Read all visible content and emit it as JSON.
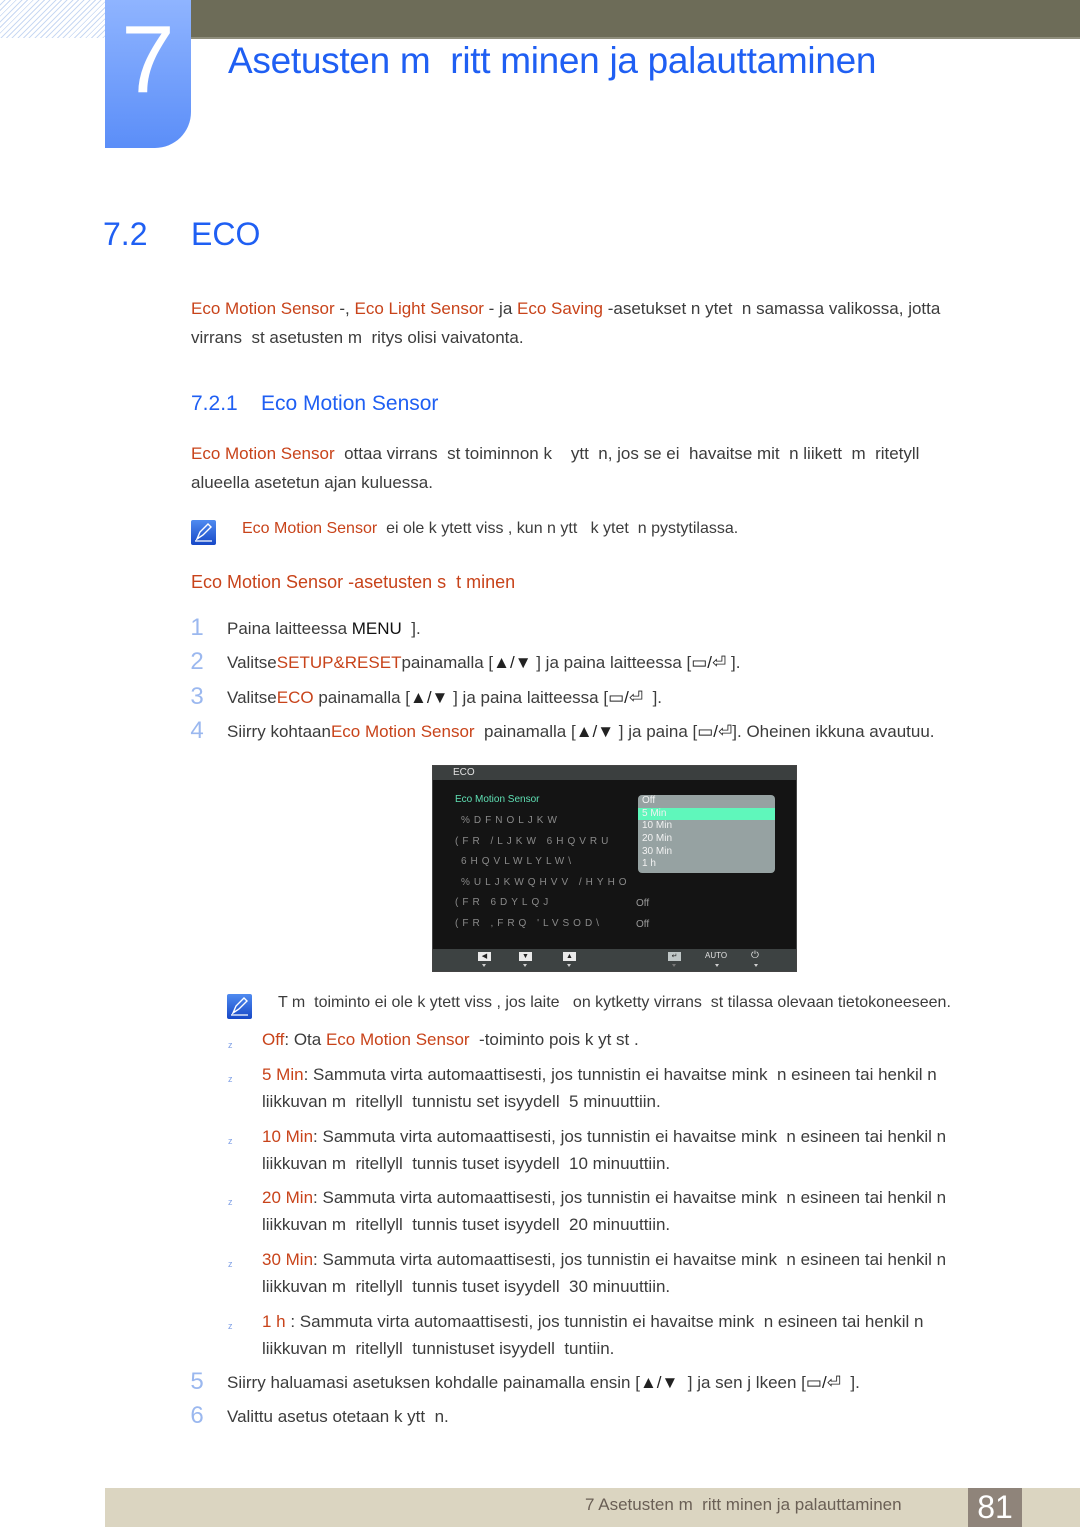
{
  "header": {
    "chapter_number": "7",
    "chapter_title": "Asetusten m  ritt minen ja palauttaminen"
  },
  "section": {
    "number": "7.2",
    "title": "ECO"
  },
  "intro": {
    "term1": "Eco Motion Sensor",
    "sep1": " -, ",
    "term2": "Eco Light Sensor",
    "sep2": " - ja ",
    "term3": "Eco Saving",
    "rest1": " -asetukset n ytet  n samassa valikossa, jotta",
    "line2": "virrans  st asetusten m  ritys olisi vaivatonta."
  },
  "subsection": {
    "number": "7.2.1",
    "title": "Eco Motion Sensor"
  },
  "description": {
    "term": "Eco Motion Sensor",
    "rest1": "  ottaa virrans  st toiminnon k    ytt  n, jos se ei  havaitse mit  n liikett  m  ritetyll",
    "line2": "alueella asetetun ajan kuluessa."
  },
  "note1": {
    "icon": "note-pencil-icon",
    "term": "Eco Motion Sensor",
    "rest": "  ei ole k ytett viss , kun n ytt   k ytet  n pystytilassa."
  },
  "procedure": {
    "title": "Eco Motion Sensor -asetusten s  t minen",
    "steps": [
      {
        "num": "1",
        "pre": "Paina laitteessa ",
        "key": "MENU",
        "post": "  ]."
      },
      {
        "num": "2",
        "pre": "Valitse",
        "term": "SETUP&RESET",
        "mid": "painamalla [",
        "mid2": " ] ja paina laitteessa [",
        "post": " ]."
      },
      {
        "num": "3",
        "pre": "Valitse",
        "term": "ECO",
        "mid": " painamalla [",
        "mid2": " ] ja paina laitteessa [",
        "post": "  ]."
      },
      {
        "num": "4",
        "pre": "Siirry kohtaan",
        "term": "Eco Motion Sensor",
        "mid": "  painamalla [",
        "mid2": " ] ja paina [",
        "post": "]. Oheinen ikkuna avautuu."
      },
      {
        "num": "5",
        "pre": "Siirry haluamasi asetuksen kohdalle painamalla ensin [",
        "mid2": "  ] ja sen j lkeen [",
        "post": "  ]."
      },
      {
        "num": "6",
        "pre": "Valittu asetus otetaan k ytt  n."
      }
    ],
    "key_updown": "▲/▼",
    "key_enter": "▭/⏎"
  },
  "osd": {
    "title": "ECO",
    "items": [
      {
        "label": "Eco Motion Sensor",
        "active": true,
        "value": ""
      },
      {
        "label": "%DFNOLJKW",
        "active": false,
        "value": ""
      },
      {
        "label": "(FR /LJKW 6HQVRU",
        "active": false,
        "value": ""
      },
      {
        "label": "6HQVLWLYLW\\",
        "active": false,
        "value": ""
      },
      {
        "label": "%ULJKWQHVV /HYHO",
        "active": false,
        "value": ""
      },
      {
        "label": "(FR 6DYLQJ",
        "active": false,
        "value": "Off"
      },
      {
        "label": "(FR ,FRQ 'LVSOD\\",
        "active": false,
        "value": "Off"
      }
    ],
    "dropdown_options": [
      "Off",
      "5 Min",
      "10 Min",
      "20 Min",
      "30 Min",
      "1 h"
    ],
    "dropdown_selected": "5 Min",
    "footer_buttons": [
      "left-arrow",
      "down-arrow",
      "up-arrow",
      "enter",
      "AUTO",
      "power"
    ],
    "auto_label": "AUTO",
    "colors": {
      "active": "#5fe0b4",
      "selected_bg": "#5ff7bb"
    }
  },
  "note2": {
    "icon": "note-pencil-icon",
    "text": "T m  toiminto ei ole k ytett viss , jos laite   on kytketty virrans  st tilassa olevaan tietokoneeseen."
  },
  "options": [
    {
      "term": "Off",
      "text1": ": Ota ",
      "term2": "Eco Motion Sensor",
      "text2": "  -toiminto pois k yt st .",
      "line2": ""
    },
    {
      "term": "5 Min",
      "text1": ": Sammuta virta automaattisesti, jos tunnistin ei havaitse mink  n esineen tai henkil n",
      "line2": "liikkuvan m  ritellyll  tunnistu set isyydell  5 minuuttiin."
    },
    {
      "term": "10 Min",
      "text1": ": Sammuta virta automaattisesti, jos tunnistin ei havaitse mink  n esineen tai henkil n",
      "line2": "liikkuvan m  ritellyll  tunnis tuset isyydell  10 minuuttiin."
    },
    {
      "term": "20 Min",
      "text1": ": Sammuta virta automaattisesti, jos tunnistin ei havaitse mink  n esineen tai henkil n",
      "line2": "liikkuvan m  ritellyll  tunnis tuset isyydell  20 minuuttiin."
    },
    {
      "term": "30 Min",
      "text1": ": Sammuta virta automaattisesti, jos tunnistin ei havaitse mink  n esineen tai henkil n",
      "line2": "liikkuvan m  ritellyll  tunnis tuset isyydell  30 minuuttiin."
    },
    {
      "term": "1 h",
      "text1": " : Sammuta virta automaattisesti, jos tunnistin ei havaitse mink  n esineen tai henkil n",
      "line2": "liikkuvan m  ritellyll  tunnistuset isyydell  tuntiin."
    }
  ],
  "bullet_glyph": "z",
  "footer": {
    "chapter_ref": "7 Asetusten m  ritt minen ja palauttaminen",
    "page_number": "81"
  },
  "colors": {
    "heading_blue": "#1f5ff3",
    "highlight_orange": "#c8431a",
    "topbar": "#6d6c58",
    "footer_bg": "#dbd5c1",
    "page_num_bg": "#8f847a"
  }
}
